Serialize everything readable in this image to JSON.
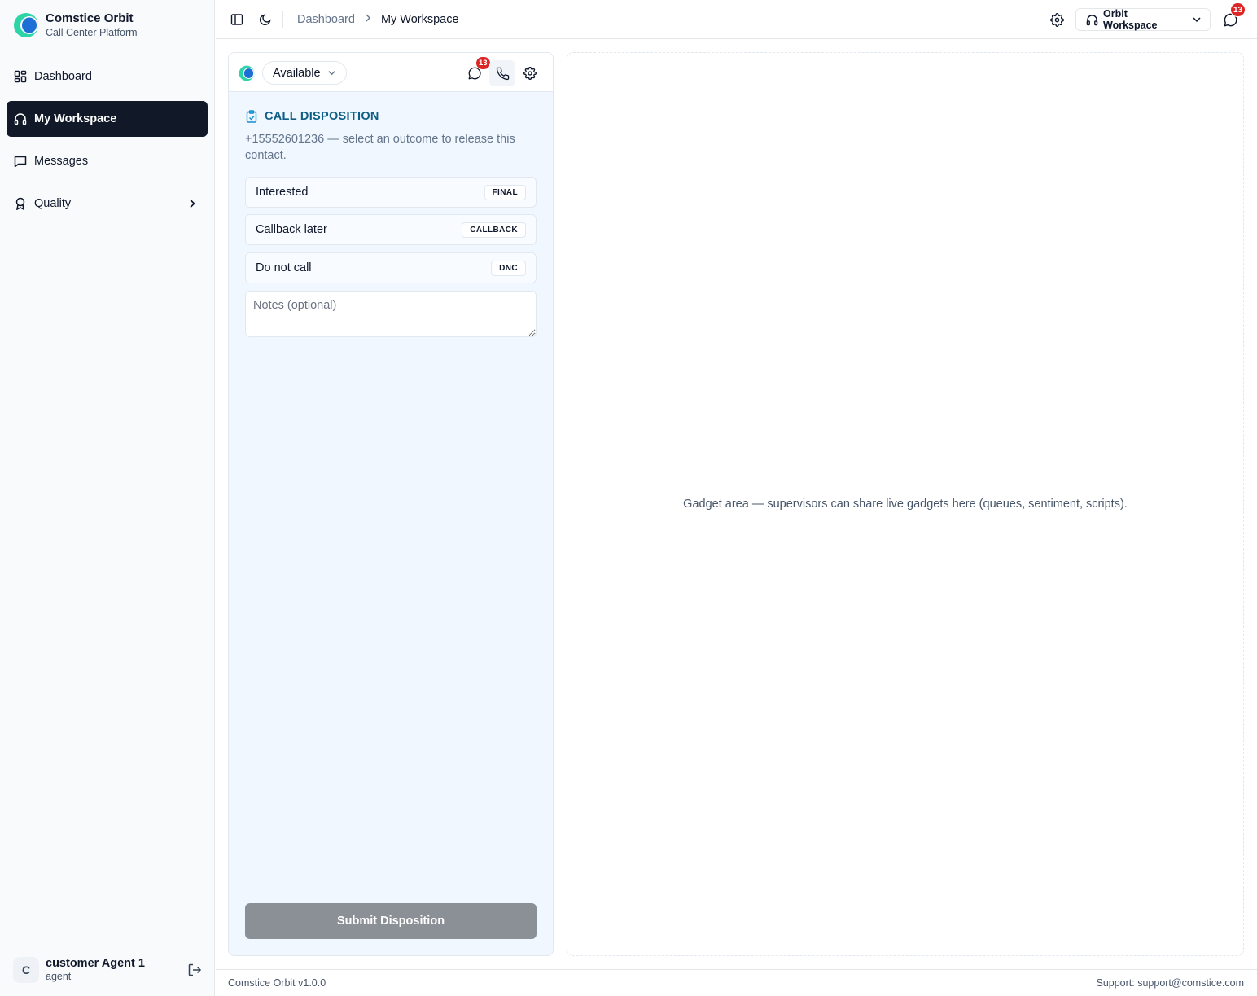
{
  "brand": {
    "name": "Comstice Orbit",
    "subtitle": "Call Center Platform",
    "logo_icon": "orbit-logo-icon"
  },
  "sidebar": {
    "items": [
      {
        "label": "Dashboard",
        "icon": "dashboard-grid-icon",
        "active": false
      },
      {
        "label": "My Workspace",
        "icon": "headphones-icon",
        "active": true
      },
      {
        "label": "Messages",
        "icon": "message-square-icon",
        "active": false
      },
      {
        "label": "Quality",
        "icon": "award-icon",
        "active": false,
        "has_chevron": true
      }
    ],
    "user": {
      "initial": "C",
      "name": "customer Agent 1",
      "role": "agent"
    }
  },
  "header": {
    "breadcrumb": {
      "parent": "Dashboard",
      "current": "My Workspace"
    },
    "workspace_select": "Orbit Workspace",
    "notification_count": "13"
  },
  "agent_panel": {
    "status": "Available",
    "message_count": "13",
    "disposition": {
      "title": "CALL DISPOSITION",
      "description": "+15552601236 — select an outcome to release this contact.",
      "options": [
        {
          "label": "Interested",
          "tag": "FINAL"
        },
        {
          "label": "Callback later",
          "tag": "CALLBACK"
        },
        {
          "label": "Do not call",
          "tag": "DNC"
        }
      ],
      "notes_placeholder": "Notes (optional)",
      "submit_label": "Submit Disposition"
    }
  },
  "gadget_area": {
    "text": "Gadget area — supervisors can share live gadgets here (queues, sentiment, scripts)."
  },
  "footer": {
    "version": "Comstice Orbit v1.0.0",
    "support": "Support: support@comstice.com"
  },
  "colors": {
    "active_nav": "#111827",
    "disposition_title": "#0e5e85",
    "badge": "#dc2626",
    "panel_bg": "#f0f7ff",
    "submit_disabled": "#8b8f96"
  }
}
